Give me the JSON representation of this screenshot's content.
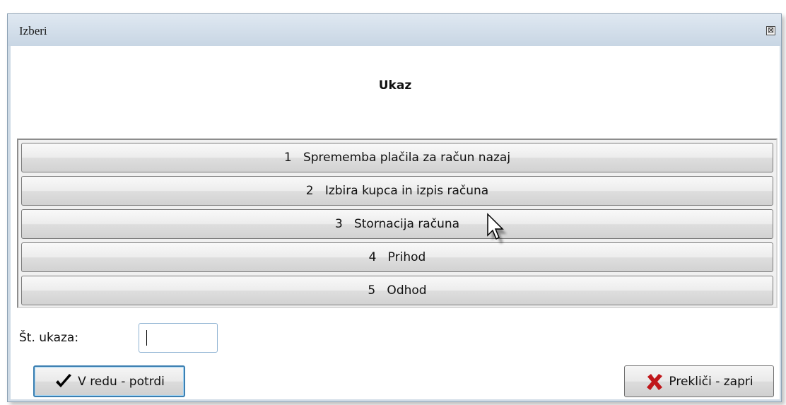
{
  "window": {
    "title": "Izberi",
    "close_symbol": "⊠"
  },
  "header": {
    "title": "Ukaz"
  },
  "commands": [
    {
      "number": "1",
      "label": "Sprememba plačila za račun nazaj"
    },
    {
      "number": "2",
      "label": "Izbira kupca in izpis računa"
    },
    {
      "number": "3",
      "label": "Stornacija računa"
    },
    {
      "number": "4",
      "label": "Prihod"
    },
    {
      "number": "5",
      "label": "Odhod"
    }
  ],
  "command_texts": [
    "1   Sprememba plačila za račun nazaj",
    "2   Izbira kupca in izpis računa",
    "3   Stornacija računa",
    "4   Prihod",
    "5   Odhod"
  ],
  "footer": {
    "number_label": "Št. ukaza:",
    "number_value": "",
    "ok_label": "V redu - potrdi",
    "cancel_label": "Prekliči - zapri"
  },
  "icons": {
    "ok": "checkmark-icon",
    "cancel": "red-x-icon",
    "close": "close-icon",
    "cursor": "mouse-pointer-icon"
  },
  "colors": {
    "title_bg": "#cfdbe6",
    "ok_border": "#3c7fb1",
    "cancel_icon": "#c0171b"
  }
}
